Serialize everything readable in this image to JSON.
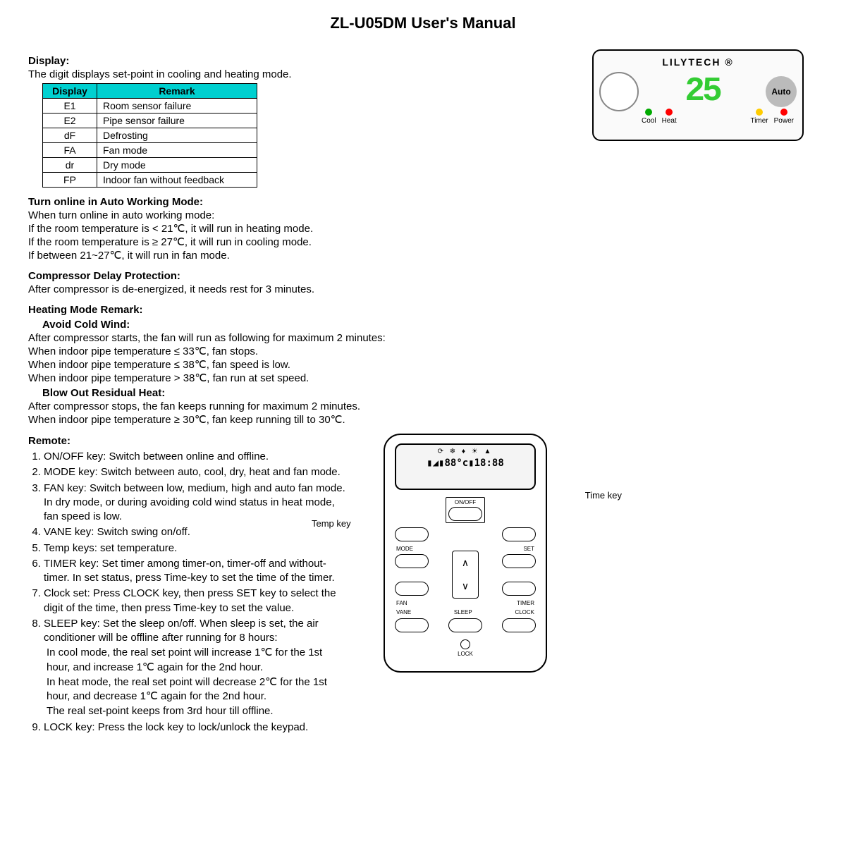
{
  "title": "ZL-U05DM User's Manual",
  "display": {
    "header": "Display:",
    "intro": "The digit displays set-point in cooling and heating mode.",
    "table_headers": [
      "Display",
      "Remark"
    ],
    "rows": [
      {
        "code": "E1",
        "remark": "Room sensor failure"
      },
      {
        "code": "E2",
        "remark": "Pipe sensor failure"
      },
      {
        "code": "dF",
        "remark": "Defrosting"
      },
      {
        "code": "FA",
        "remark": "Fan mode"
      },
      {
        "code": "dr",
        "remark": "Dry mode"
      },
      {
        "code": "FP",
        "remark": "Indoor fan without feedback"
      }
    ]
  },
  "panel": {
    "brand": "LILYTECH ®",
    "value": "25",
    "auto": "Auto",
    "leds": {
      "cool": "Cool",
      "heat": "Heat",
      "timer": "Timer",
      "power": "Power"
    }
  },
  "auto_mode": {
    "header": "Turn online in Auto Working Mode:",
    "intro": "When turn online in auto working mode:",
    "lines": [
      "If the room temperature is < 21℃, it will run in heating mode.",
      "If the room temperature is ≥ 27℃, it will run in cooling mode.",
      "If between 21~27℃, it will run in fan mode."
    ]
  },
  "compressor": {
    "header": "Compressor Delay Protection:",
    "line": "After compressor is de-energized, it needs rest for 3 minutes."
  },
  "heating": {
    "header": "Heating Mode Remark:",
    "avoid_header": "Avoid Cold Wind:",
    "avoid_intro": "After compressor starts, the fan will run as following for maximum 2 minutes:",
    "avoid_lines": [
      "When indoor pipe temperature ≤ 33℃, fan stops.",
      "When indoor pipe temperature ≤ 38℃, fan speed is low.",
      "When indoor pipe temperature > 38℃, fan run at set speed."
    ],
    "blow_header": "Blow Out Residual Heat:",
    "blow_intro": "After compressor stops, the fan keeps running for maximum 2 minutes.",
    "blow_line": "When indoor pipe temperature ≥ 30℃, fan keep running till to 30℃."
  },
  "remote": {
    "header": "Remote:",
    "temp_key_label": "Temp key",
    "time_key_label": "Time key",
    "screen_icons": "⟳ ❄ ♦ ☀ ▲",
    "screen_digits": "▮◢▮88°c▮18:88",
    "btn": {
      "onoff": "ON/OFF",
      "mode": "MODE",
      "set": "SET",
      "fan": "FAN",
      "timer": "TIMER",
      "vane": "VANE",
      "sleep": "SLEEP",
      "clock": "CLOCK",
      "lock": "LOCK",
      "up": "∧",
      "down": "∨"
    },
    "items": [
      "ON/OFF key: Switch between online and offline.",
      "MODE key: Switch between auto, cool, dry, heat and fan mode.",
      "FAN key: Switch between low, medium, high and auto fan mode. In dry mode, or during avoiding cold wind status in heat mode, fan speed is low.",
      "VANE key: Switch swing on/off.",
      "Temp keys: set temperature.",
      "TIMER key: Set timer among timer-on, timer-off and without-timer. In set status, press Time-key to set the time of the timer.",
      "Clock set: Press CLOCK key, then press SET key to select the digit of the time, then press Time-key to set the value.",
      "SLEEP key: Set the sleep on/off. When sleep is set, the air conditioner will be offline after running for 8 hours:",
      "LOCK key: Press the lock key to lock/unlock the keypad."
    ],
    "sleep_sub": [
      "In cool mode, the real set point will increase 1℃ for the 1st hour, and increase 1℃ again for the 2nd hour.",
      "In heat mode, the real set point will decrease 2℃ for the 1st hour, and decrease 1℃ again for the 2nd hour.",
      "The real set-point keeps from 3rd hour till offline."
    ]
  }
}
